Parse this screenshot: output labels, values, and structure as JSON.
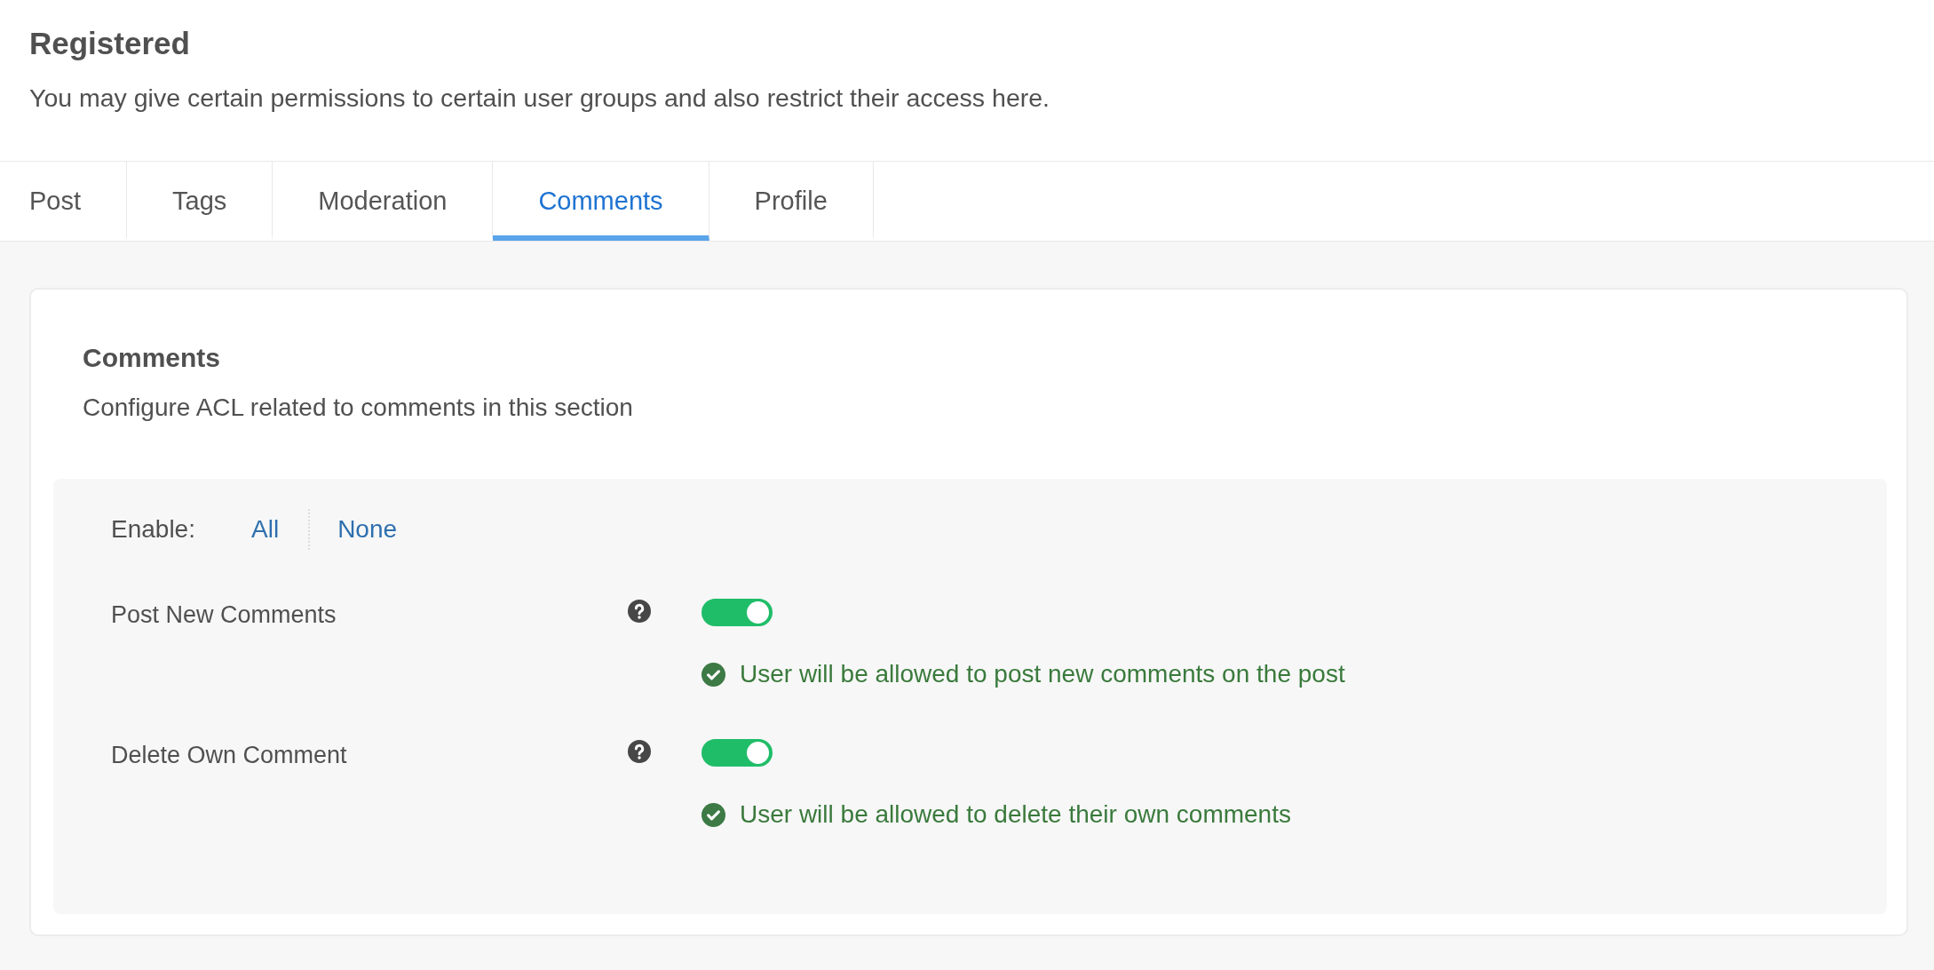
{
  "header": {
    "title": "Registered",
    "description": "You may give certain permissions to certain user groups and also restrict their access here."
  },
  "tabs": [
    {
      "label": "Post",
      "selected": false
    },
    {
      "label": "Tags",
      "selected": false
    },
    {
      "label": "Moderation",
      "selected": false
    },
    {
      "label": "Comments",
      "selected": true
    },
    {
      "label": "Profile",
      "selected": false
    }
  ],
  "section": {
    "title": "Comments",
    "description": "Configure ACL related to comments in this section",
    "enable": {
      "label": "Enable:",
      "links": [
        "All",
        "None"
      ]
    },
    "permissions": [
      {
        "label": "Post New Comments",
        "on": true,
        "message": "User will be allowed to post new comments on the post"
      },
      {
        "label": "Delete Own Comment",
        "on": true,
        "message": "User will be allowed to delete their own comments"
      }
    ]
  }
}
